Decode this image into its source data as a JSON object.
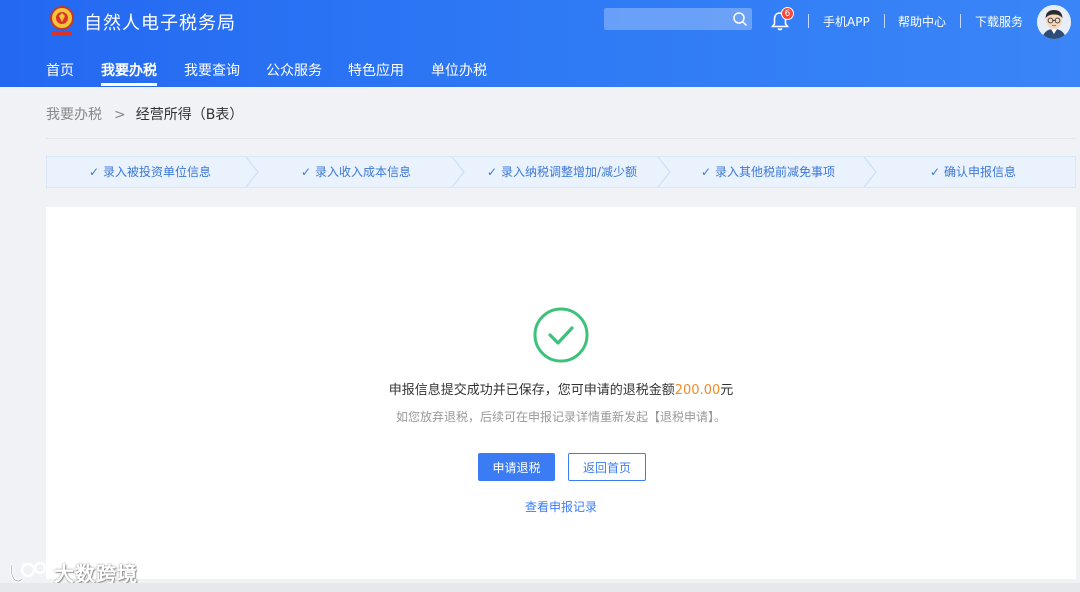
{
  "header": {
    "site_title": "自然人电子税务局",
    "notification_count": "6",
    "links": [
      "手机APP",
      "帮助中心",
      "下载服务"
    ],
    "accent_color": "#2468f2"
  },
  "nav": {
    "items": [
      "首页",
      "我要办税",
      "我要查询",
      "公众服务",
      "特色应用",
      "单位办税"
    ],
    "active": "我要办税"
  },
  "breadcrumb": {
    "parent": "我要办税",
    "separator": ">",
    "current": "经营所得（B表）"
  },
  "steps": [
    "录入被投资单位信息",
    "录入收入成本信息",
    "录入纳税调整增加/减少额",
    "录入其他税前减免事项",
    "确认申报信息"
  ],
  "result": {
    "message_prefix": "申报信息提交成功并已保存，您可申请的退税金额",
    "amount": "200.00",
    "message_suffix": "元",
    "sub_message": "如您放弃退税，后续可在申报记录详情重新发起【退税申请】。",
    "primary_button": "申请退税",
    "secondary_button": "返回首页",
    "link": "查看申报记录",
    "success_color": "#3cc27a",
    "amount_color": "#f08a24"
  },
  "watermark": {
    "text": "大数跨境"
  }
}
